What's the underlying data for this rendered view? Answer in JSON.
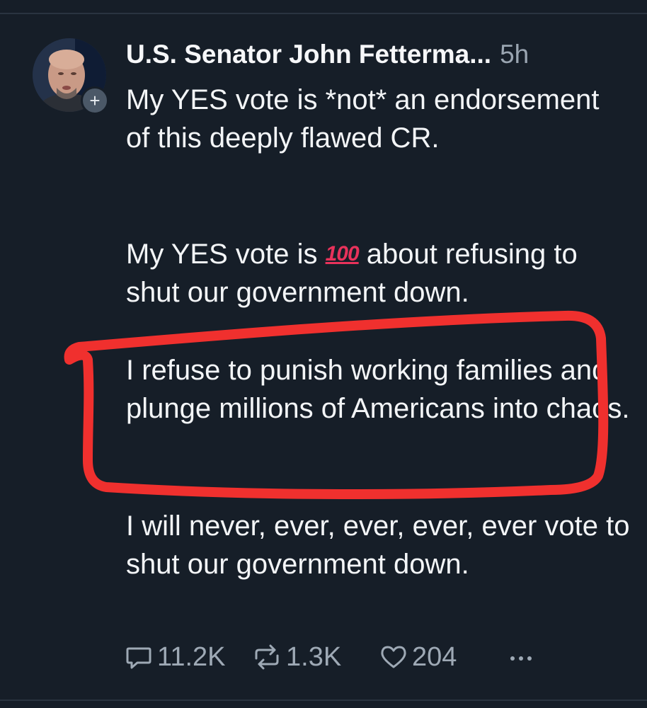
{
  "post": {
    "author": "U.S. Senator John Fetterma...",
    "time": "5h",
    "paragraph1": "My YES vote is *not* an endorsement of this deeply flawed CR.",
    "paragraph2_before": "My YES vote is",
    "paragraph2_emoji": "100",
    "paragraph2_after": "about refusing to shut our government down.",
    "paragraph3": "I refuse to punish working families and plunge millions of Americans into chaos.",
    "paragraph4": "I will never, ever, ever, ever, ever vote to shut our government down."
  },
  "actions": {
    "replies": "11.2K",
    "reposts": "1.3K",
    "likes": "204"
  },
  "icons": {
    "reply": "reply-icon",
    "repost": "repost-icon",
    "like": "heart-icon",
    "more": "more-icon",
    "follow": "plus-icon",
    "emoji": "hundred-points-emoji"
  },
  "colors": {
    "background": "#161e28",
    "text": "#f3f5f7",
    "muted": "#9ea9b5",
    "highlight_circle": "#f0302e",
    "hundred_emoji": "#e8325b"
  }
}
